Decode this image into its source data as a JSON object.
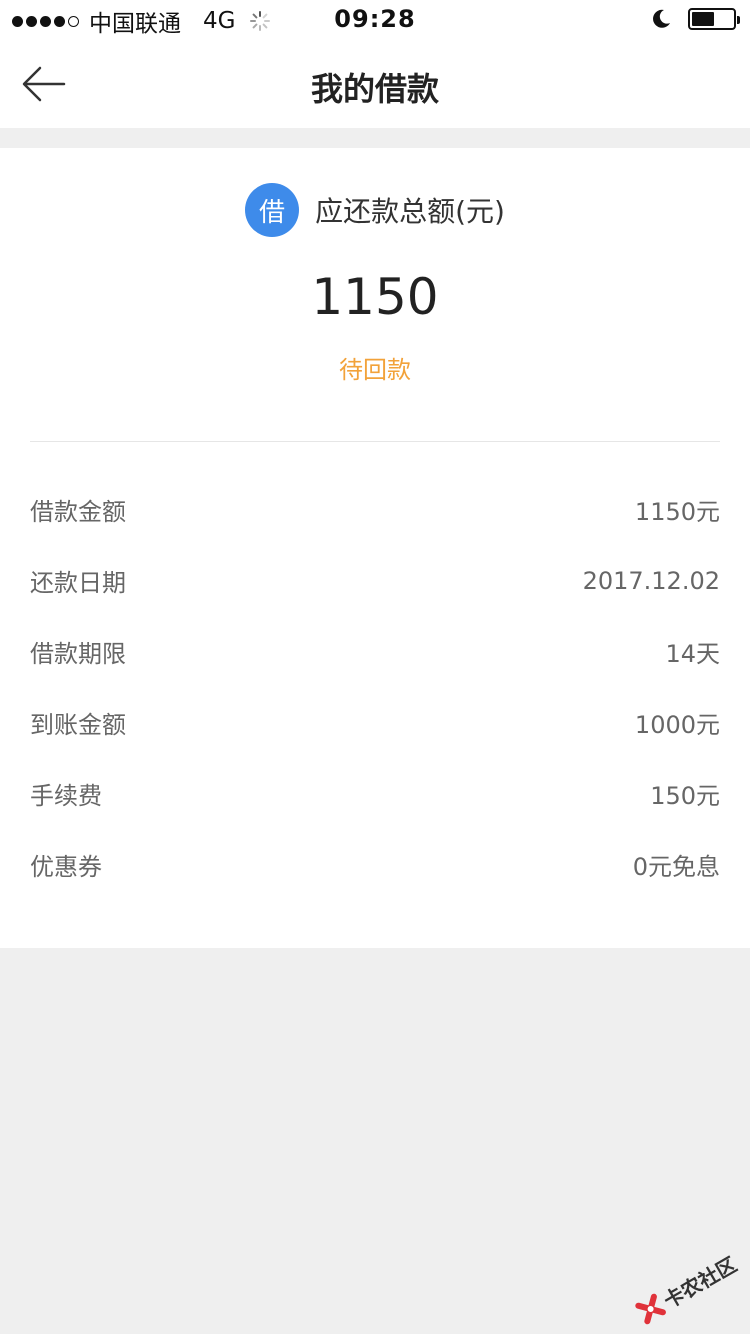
{
  "status_bar": {
    "carrier": "中国联通",
    "network": "4G",
    "time": "09:28",
    "battery_level": 0.55
  },
  "nav": {
    "title": "我的借款"
  },
  "summary": {
    "badge": "借",
    "label": "应还款总额(元)",
    "amount": "1150",
    "status": "待回款",
    "status_color": "#f2a23a",
    "badge_color": "#3e8bea"
  },
  "details": [
    {
      "label": "借款金额",
      "value": "1150元"
    },
    {
      "label": "还款日期",
      "value": "2017.12.02"
    },
    {
      "label": "借款期限",
      "value": "14天"
    },
    {
      "label": "到账金额",
      "value": "1000元"
    },
    {
      "label": "手续费",
      "value": "150元"
    },
    {
      "label": "优惠券",
      "value": "0元免息"
    }
  ],
  "watermark": {
    "text": "卡农社区"
  }
}
